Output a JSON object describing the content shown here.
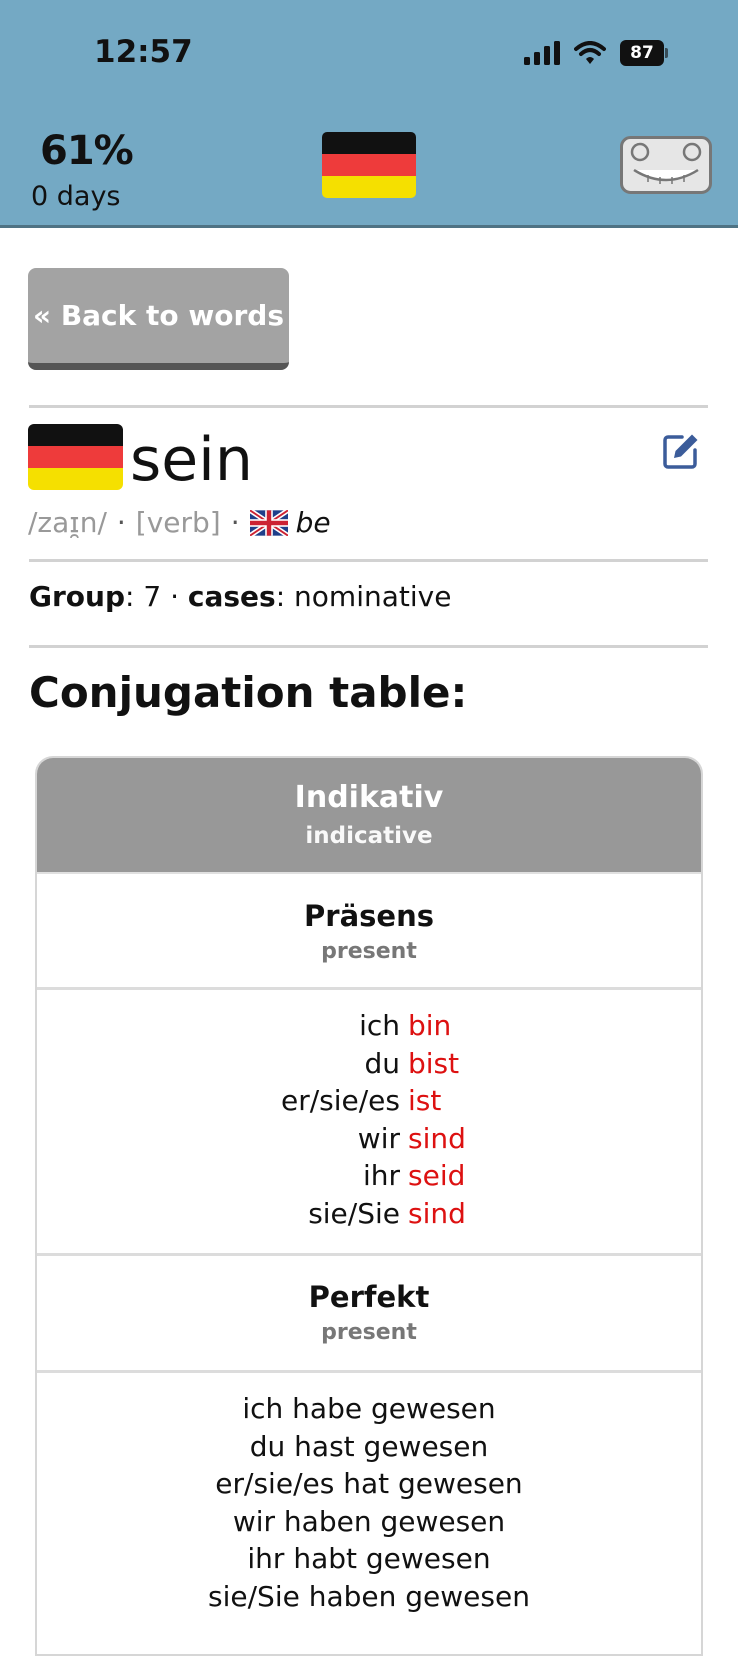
{
  "status_bar": {
    "time": "12:57",
    "battery": "87"
  },
  "header": {
    "streak_percent": "61%",
    "streak_days": "0 days",
    "language_flag": "de-flag-icon",
    "mascot": "robot-mascot-icon"
  },
  "back_button_label": "« Back to words",
  "word": {
    "title": "sein",
    "pronunciation": "/zaɪ̯n/",
    "separator": "·",
    "part_of_speech": "[verb]",
    "translation": "be",
    "group_label": "Group",
    "group_value": ": 7 ·",
    "cases_label": "cases",
    "cases_value": ": nominative"
  },
  "colors": {
    "header_bg": "#74a9c4",
    "conjugated_form": "#dd1111",
    "flag_black": "#111111",
    "flag_red": "#ee3b3b",
    "flag_gold": "#f5e000"
  },
  "section_heading": "Conjugation table:",
  "table": {
    "mood": "Indikativ",
    "mood_en": "indicative",
    "tenses": [
      {
        "name": "Präsens",
        "name_en": "present",
        "rows": [
          {
            "pronoun": "ich",
            "verb": "bin"
          },
          {
            "pronoun": "du",
            "verb": "bist"
          },
          {
            "pronoun": "er/sie/es",
            "verb": "ist"
          },
          {
            "pronoun": "wir",
            "verb": "sind"
          },
          {
            "pronoun": "ihr",
            "verb": "seid"
          },
          {
            "pronoun": "sie/Sie",
            "verb": "sind"
          }
        ]
      },
      {
        "name": "Perfekt",
        "name_en": "present",
        "rows": [
          "ich habe gewesen",
          "du hast gewesen",
          "er/sie/es hat gewesen",
          "wir haben gewesen",
          "ihr habt gewesen",
          "sie/Sie haben gewesen"
        ]
      }
    ]
  }
}
